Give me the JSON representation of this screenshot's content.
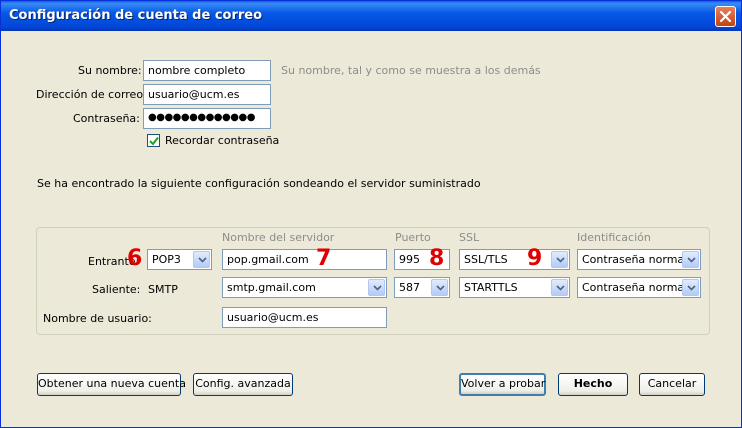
{
  "window": {
    "title": "Configuración de cuenta de correo"
  },
  "form": {
    "name_label": "Su nombre:",
    "name_value": "nombre completo",
    "name_hint": "Su nombre, tal y como se muestra a los demás",
    "email_label": "Dirección de correo:",
    "email_value": "usuario@ucm.es",
    "password_label": "Contraseña:",
    "password_value": "●●●●●●●●●●●●●",
    "remember_label": "Recordar contraseña",
    "remember_checked": true
  },
  "message": "Se ha encontrado la siguiente configuración sondeando el servidor suministrado",
  "server": {
    "headers": {
      "server": "Nombre del servidor",
      "port": "Puerto",
      "ssl": "SSL",
      "auth": "Identificación"
    },
    "incoming": {
      "label": "Entrante:",
      "protocol": "POP3",
      "host": "pop.gmail.com",
      "port": "995",
      "ssl": "SSL/TLS",
      "auth": "Contraseña normal"
    },
    "outgoing": {
      "label": "Saliente:",
      "protocol": "SMTP",
      "host": "smtp.gmail.com",
      "port": "587",
      "ssl": "STARTTLS",
      "auth": "Contraseña normal"
    },
    "username_label": "Nombre de usuario:",
    "username_value": "usuario@ucm.es"
  },
  "markers": [
    "6",
    "7",
    "8",
    "9"
  ],
  "buttons": {
    "new_account": "Obtener una nueva cuenta",
    "advanced": "Config. avanzada",
    "retest": "Volver a probar",
    "done": "Hecho",
    "cancel": "Cancelar"
  },
  "colors": {
    "titlebar": "#0558e6",
    "marker": "#e00000",
    "window_bg": "#ece9d8"
  }
}
